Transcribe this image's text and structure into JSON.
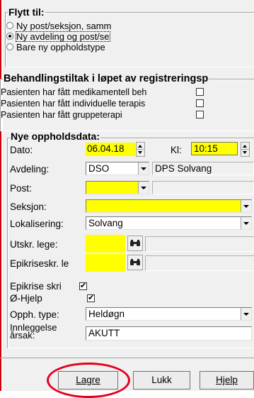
{
  "moved_to": {
    "title": "Flytt til:",
    "options": [
      {
        "label": "Ny post/seksjon, samm",
        "selected": false
      },
      {
        "label": "Ny avdeling og post/se",
        "selected": true
      },
      {
        "label": "Bare ny oppholdstype",
        "selected": false
      }
    ]
  },
  "treatment": {
    "title": "Behandlingstiltak i løpet av registreringsp",
    "items": [
      {
        "label": "Pasienten har fått medikamentell beh",
        "checked": false
      },
      {
        "label": "Pasienten har fått individuelle terapis",
        "checked": false
      },
      {
        "label": "Pasienten har fått gruppeterapi",
        "checked": false
      }
    ]
  },
  "stay": {
    "title": "Nye oppholdsdata:",
    "date_label": "Dato:",
    "date_value": "06.04.18",
    "time_label": "Kl:",
    "time_value": "10:15",
    "department_label": "Avdeling:",
    "department_code": "DSO",
    "department_name": "DPS Solvang",
    "post_label": "Post:",
    "post_value": "",
    "section_label": "Seksjon:",
    "section_value": "",
    "location_label": "Lokalisering:",
    "location_value": "Solvang",
    "discharge_doctor_label": "Utskr. lege:",
    "discharge_doctor_value": "",
    "epicrisis_doctor_label": "Epikriseskr. le",
    "epicrisis_doctor_value": "",
    "epicrisis_write_label": "Epikrise skri",
    "epicrisis_write_checked": true,
    "emergency_help_label": "Ø-Hjelp",
    "emergency_help_checked": true,
    "stay_type_label": "Opph. type:",
    "stay_type_value": "Heldøgn",
    "admission_reason_label": "Innleggelse årsak:",
    "admission_reason_value": "AKUTT"
  },
  "buttons": {
    "save": "Lagre",
    "close": "Lukk",
    "help": "Hjelp"
  },
  "colors": {
    "required_field": "#ffff00",
    "highlight_ellipse": "#e4001b"
  }
}
